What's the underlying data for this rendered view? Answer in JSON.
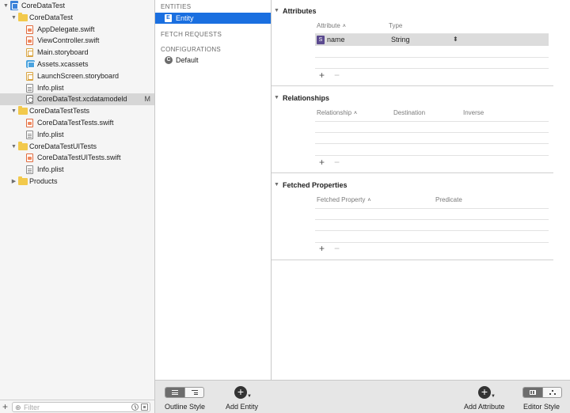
{
  "navigator": {
    "items": [
      {
        "label": "CoreDataTest",
        "kind": "project",
        "indent": 0,
        "expanded": true,
        "badge": ""
      },
      {
        "label": "CoreDataTest",
        "kind": "folder",
        "indent": 1,
        "expanded": true,
        "badge": ""
      },
      {
        "label": "AppDelegate.swift",
        "kind": "swift",
        "indent": 2,
        "badge": ""
      },
      {
        "label": "ViewController.swift",
        "kind": "swift",
        "indent": 2,
        "badge": ""
      },
      {
        "label": "Main.storyboard",
        "kind": "storyboard",
        "indent": 2,
        "badge": ""
      },
      {
        "label": "Assets.xcassets",
        "kind": "assets",
        "indent": 2,
        "badge": ""
      },
      {
        "label": "LaunchScreen.storyboard",
        "kind": "storyboard",
        "indent": 2,
        "badge": ""
      },
      {
        "label": "Info.plist",
        "kind": "plist",
        "indent": 2,
        "badge": ""
      },
      {
        "label": "CoreDataTest.xcdatamodeld",
        "kind": "model",
        "indent": 2,
        "badge": "M",
        "selected": true
      },
      {
        "label": "CoreDataTestTests",
        "kind": "folder",
        "indent": 1,
        "expanded": true,
        "badge": ""
      },
      {
        "label": "CoreDataTestTests.swift",
        "kind": "swift",
        "indent": 2,
        "badge": ""
      },
      {
        "label": "Info.plist",
        "kind": "plist",
        "indent": 2,
        "badge": ""
      },
      {
        "label": "CoreDataTestUITests",
        "kind": "folder",
        "indent": 1,
        "expanded": true,
        "badge": ""
      },
      {
        "label": "CoreDataTestUITests.swift",
        "kind": "swift",
        "indent": 2,
        "badge": ""
      },
      {
        "label": "Info.plist",
        "kind": "plist",
        "indent": 2,
        "badge": ""
      },
      {
        "label": "Products",
        "kind": "folder",
        "indent": 1,
        "expanded": false,
        "badge": ""
      }
    ],
    "filter": {
      "placeholder": "Filter",
      "value": ""
    },
    "add_glyph": "+"
  },
  "outline": {
    "entities_header": "ENTITIES",
    "entities": [
      {
        "label": "Entity",
        "badge": "E",
        "selected": true
      }
    ],
    "fetch_requests_header": "FETCH REQUESTS",
    "configurations_header": "CONFIGURATIONS",
    "configurations": [
      {
        "label": "Default",
        "badge": "C"
      }
    ]
  },
  "editor": {
    "attributes": {
      "title": "Attributes",
      "columns": [
        "Attribute",
        "Type"
      ],
      "rows": [
        {
          "badge": "S",
          "name": "name",
          "type": "String"
        }
      ]
    },
    "relationships": {
      "title": "Relationships",
      "columns": [
        "Relationship",
        "Destination",
        "Inverse"
      ]
    },
    "fetched_properties": {
      "title": "Fetched Properties",
      "columns": [
        "Fetched Property",
        "Predicate"
      ]
    },
    "plus_glyph": "+",
    "minus_glyph": "−",
    "sort_glyph": "˄",
    "stepper_glyph": "⬍",
    "disclosure_glyph": "▼"
  },
  "toolbar": {
    "outline_style_label": "Outline Style",
    "add_entity_label": "Add Entity",
    "add_attribute_label": "Add Attribute",
    "editor_style_label": "Editor Style"
  },
  "colors": {
    "selection_blue": "#1a6fe0",
    "attribute_badge": "#5b4a8f",
    "folder_yellow": "#f2c94c",
    "project_blue": "#3b82d9"
  }
}
